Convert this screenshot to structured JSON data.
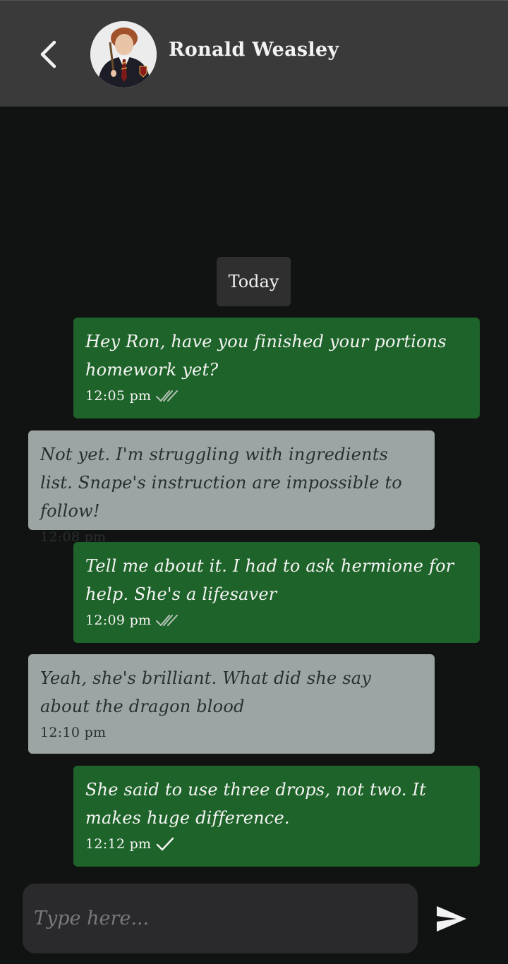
{
  "header": {
    "contact_name": "Ronald Weasley"
  },
  "chat": {
    "date_label": "Today",
    "messages": [
      {
        "direction": "sent",
        "text": "Hey Ron, have you finished your portions homework yet?",
        "time": "12:05 pm",
        "status": "read"
      },
      {
        "direction": "received",
        "text": "Not yet. I'm struggling with ingredients list. Snape's instruction are impossible to follow!",
        "time": "12:08 pm"
      },
      {
        "direction": "sent",
        "text": "Tell me about it. I had to ask hermione for help. She's a lifesaver",
        "time": "12:09 pm",
        "status": "read"
      },
      {
        "direction": "received",
        "text": "Yeah, she's brilliant. What did she say about the dragon blood",
        "time": "12:10 pm"
      },
      {
        "direction": "sent",
        "text": "She said to use three drops, not two. It makes huge difference.",
        "time": "12:12 pm",
        "status": "sent"
      }
    ]
  },
  "composer": {
    "placeholder": "Type here..."
  },
  "colors": {
    "header_bg": "#3a3a3a",
    "chat_bg": "#111312",
    "sent_bubble": "#1e6329",
    "received_bubble": "#9da5a4",
    "input_bg": "#2a2a2c"
  },
  "icons": {
    "back": "chevron-left-icon",
    "send": "send-icon",
    "read": "double-check-icon",
    "sent": "check-icon"
  }
}
